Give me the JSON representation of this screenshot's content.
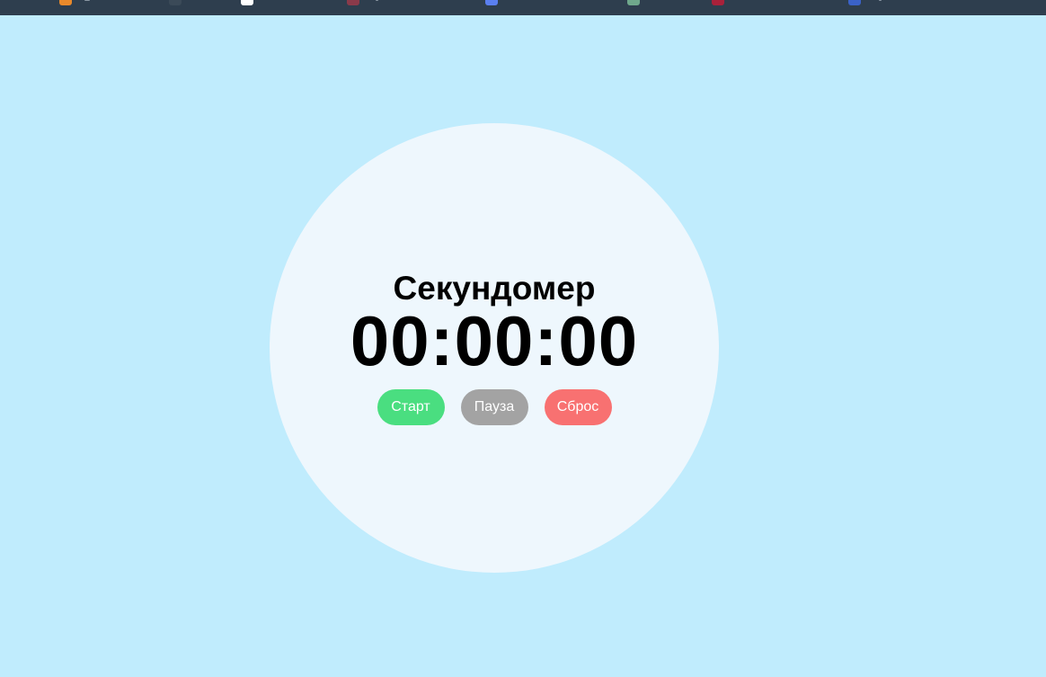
{
  "bookmarks_bar": {
    "icons": [
      {
        "name": "bookmark-favicon-orange-icon",
        "color": "#e8892b"
      },
      {
        "name": "bookmark-favicon-dark-icon",
        "color": "#3b4a58"
      },
      {
        "name": "bookmark-favicon-white-icon",
        "color": "#ffffff"
      },
      {
        "name": "bookmark-favicon-red-icon",
        "color": "#8a3a4a"
      },
      {
        "name": "bookmark-favicon-blue-icon",
        "color": "#5a7ff0"
      },
      {
        "name": "bookmark-favicon-green-icon",
        "color": "#6fa88c"
      },
      {
        "name": "bookmark-favicon-crimson-icon",
        "color": "#a8213a"
      },
      {
        "name": "bookmark-favicon-navy-icon",
        "color": "#3a62c8"
      }
    ]
  },
  "stopwatch": {
    "title": "Секундомер",
    "time": "00:00:00",
    "buttons": {
      "start": {
        "label": "Старт",
        "color": "#4ade80"
      },
      "pause": {
        "label": "Пауза",
        "color": "#a3a3a3"
      },
      "reset": {
        "label": "Сброс",
        "color": "#f87171"
      }
    }
  },
  "colors": {
    "background": "#c0ecfd",
    "circle": "#eef7fd",
    "bookmarks_bar": "#2e3e4e"
  }
}
